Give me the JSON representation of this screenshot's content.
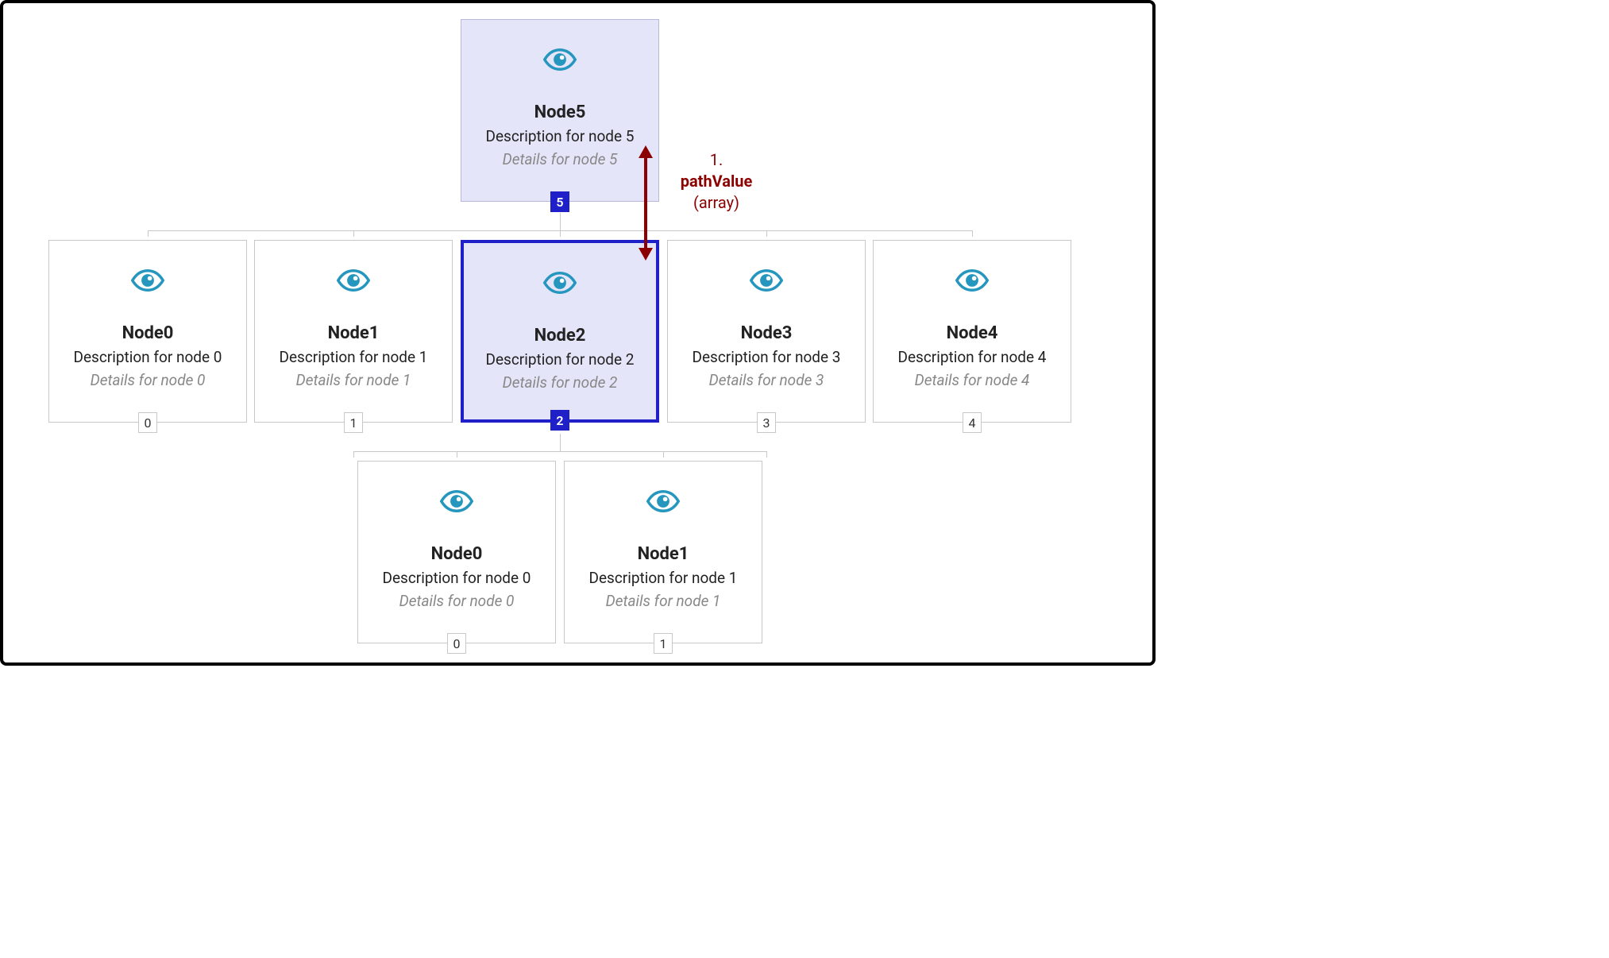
{
  "annotation": {
    "line1": "1.",
    "line2": "pathValue",
    "line3": "(array)"
  },
  "tree": {
    "root": {
      "title": "Node5",
      "desc": "Description for node 5",
      "details": "Details for node 5",
      "badge": "5",
      "icon": "eye-icon"
    },
    "middle": [
      {
        "title": "Node0",
        "desc": "Description for node 0",
        "details": "Details for node 0",
        "badge": "0",
        "icon": "eye-icon"
      },
      {
        "title": "Node1",
        "desc": "Description for node 1",
        "details": "Details for node 1",
        "badge": "1",
        "icon": "eye-icon"
      },
      {
        "title": "Node2",
        "desc": "Description for node 2",
        "details": "Details for node 2",
        "badge": "2",
        "icon": "eye-icon"
      },
      {
        "title": "Node3",
        "desc": "Description for node 3",
        "details": "Details for node 3",
        "badge": "3",
        "icon": "eye-icon"
      },
      {
        "title": "Node4",
        "desc": "Description for node 4",
        "details": "Details for node 4",
        "badge": "4",
        "icon": "eye-icon"
      }
    ],
    "bottom": [
      {
        "title": "Node0",
        "desc": "Description for node 0",
        "details": "Details for node 0",
        "badge": "0",
        "icon": "eye-icon"
      },
      {
        "title": "Node1",
        "desc": "Description for node 1",
        "details": "Details for node 1",
        "badge": "1",
        "icon": "eye-icon"
      }
    ]
  },
  "colors": {
    "selected_border": "#2020c8",
    "highlight_bg": "#e5e5fa",
    "annotation": "#8b0000",
    "icon": "#2596be"
  }
}
